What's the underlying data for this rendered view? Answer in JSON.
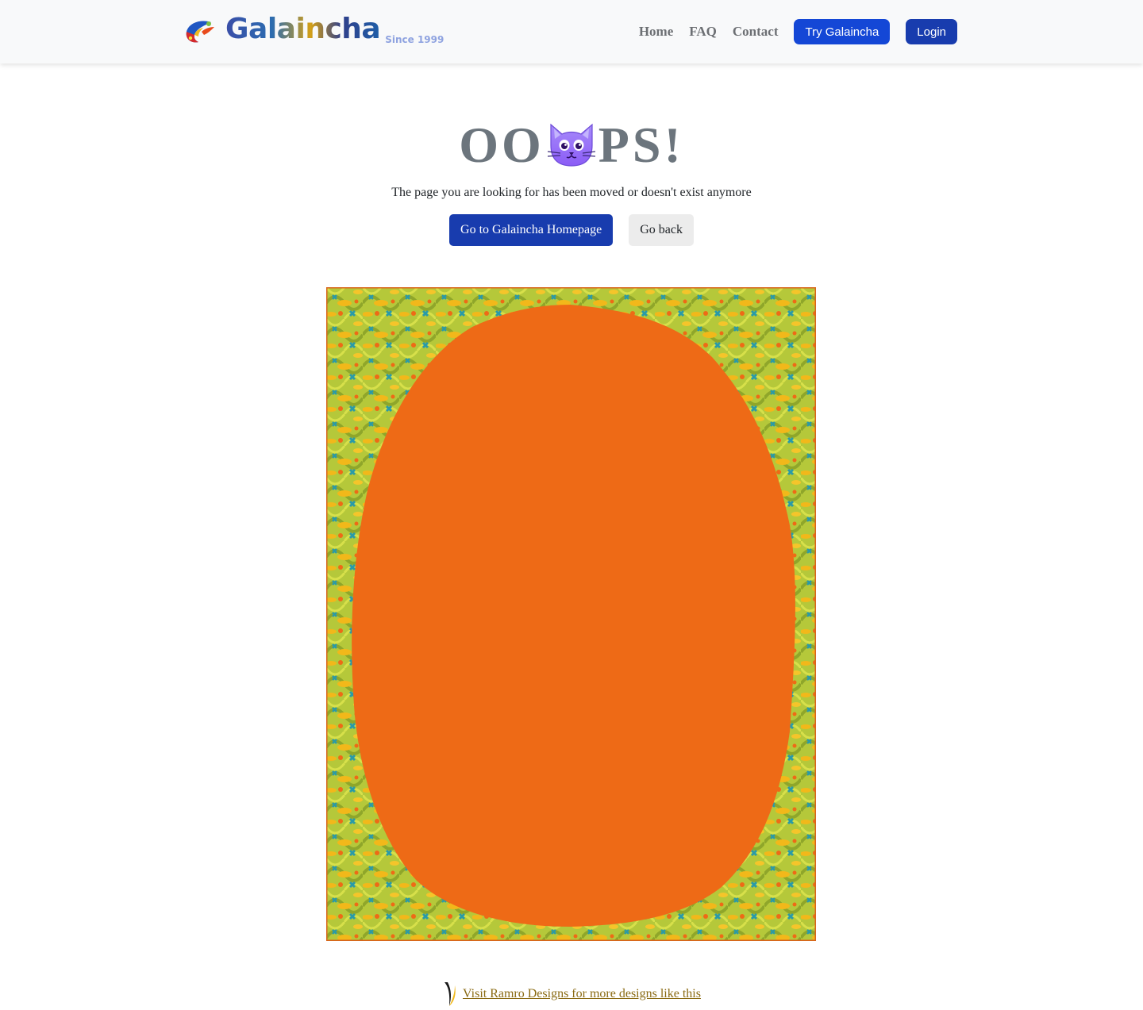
{
  "nav": {
    "brand_name": "Galaincha",
    "brand_since": "Since 1999",
    "links": {
      "home": "Home",
      "faq": "FAQ",
      "contact": "Contact"
    },
    "try_label": "Try Galaincha",
    "login_label": "Login"
  },
  "error": {
    "heading_before": "OO",
    "heading_after": "PS!",
    "message": "The page you are looking for has been moved or doesn't exist anymore",
    "home_button": "Go to Galaincha Homepage",
    "back_button": "Go back"
  },
  "footer": {
    "visit_link": "Visit Ramro Designs for more designs like this"
  },
  "colors": {
    "primary_button": "#183cae",
    "try_button": "#1447d6",
    "rug_field": "#ee6a16",
    "rug_border_green": "#b5c83a",
    "rug_border_yellow": "#f2b81a",
    "rug_border_teal": "#2a9aa8",
    "link_gold": "#8a6a12"
  },
  "icons": {
    "brand": "galaincha-logo-icon",
    "cat": "cat-face-icon",
    "ramro": "ramro-logo-icon"
  }
}
